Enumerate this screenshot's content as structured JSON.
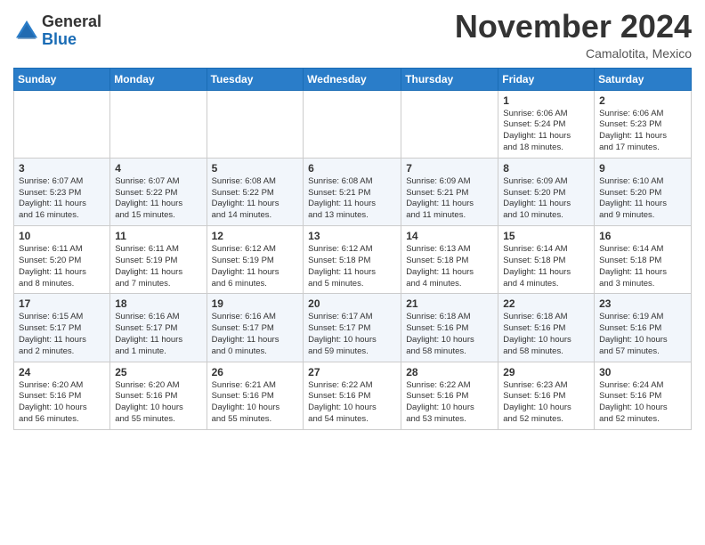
{
  "header": {
    "logo_line1": "General",
    "logo_line2": "Blue",
    "month": "November 2024",
    "location": "Camalotita, Mexico"
  },
  "weekdays": [
    "Sunday",
    "Monday",
    "Tuesday",
    "Wednesday",
    "Thursday",
    "Friday",
    "Saturday"
  ],
  "weeks": [
    [
      {
        "day": "",
        "info": ""
      },
      {
        "day": "",
        "info": ""
      },
      {
        "day": "",
        "info": ""
      },
      {
        "day": "",
        "info": ""
      },
      {
        "day": "",
        "info": ""
      },
      {
        "day": "1",
        "info": "Sunrise: 6:06 AM\nSunset: 5:24 PM\nDaylight: 11 hours\nand 18 minutes."
      },
      {
        "day": "2",
        "info": "Sunrise: 6:06 AM\nSunset: 5:23 PM\nDaylight: 11 hours\nand 17 minutes."
      }
    ],
    [
      {
        "day": "3",
        "info": "Sunrise: 6:07 AM\nSunset: 5:23 PM\nDaylight: 11 hours\nand 16 minutes."
      },
      {
        "day": "4",
        "info": "Sunrise: 6:07 AM\nSunset: 5:22 PM\nDaylight: 11 hours\nand 15 minutes."
      },
      {
        "day": "5",
        "info": "Sunrise: 6:08 AM\nSunset: 5:22 PM\nDaylight: 11 hours\nand 14 minutes."
      },
      {
        "day": "6",
        "info": "Sunrise: 6:08 AM\nSunset: 5:21 PM\nDaylight: 11 hours\nand 13 minutes."
      },
      {
        "day": "7",
        "info": "Sunrise: 6:09 AM\nSunset: 5:21 PM\nDaylight: 11 hours\nand 11 minutes."
      },
      {
        "day": "8",
        "info": "Sunrise: 6:09 AM\nSunset: 5:20 PM\nDaylight: 11 hours\nand 10 minutes."
      },
      {
        "day": "9",
        "info": "Sunrise: 6:10 AM\nSunset: 5:20 PM\nDaylight: 11 hours\nand 9 minutes."
      }
    ],
    [
      {
        "day": "10",
        "info": "Sunrise: 6:11 AM\nSunset: 5:20 PM\nDaylight: 11 hours\nand 8 minutes."
      },
      {
        "day": "11",
        "info": "Sunrise: 6:11 AM\nSunset: 5:19 PM\nDaylight: 11 hours\nand 7 minutes."
      },
      {
        "day": "12",
        "info": "Sunrise: 6:12 AM\nSunset: 5:19 PM\nDaylight: 11 hours\nand 6 minutes."
      },
      {
        "day": "13",
        "info": "Sunrise: 6:12 AM\nSunset: 5:18 PM\nDaylight: 11 hours\nand 5 minutes."
      },
      {
        "day": "14",
        "info": "Sunrise: 6:13 AM\nSunset: 5:18 PM\nDaylight: 11 hours\nand 4 minutes."
      },
      {
        "day": "15",
        "info": "Sunrise: 6:14 AM\nSunset: 5:18 PM\nDaylight: 11 hours\nand 4 minutes."
      },
      {
        "day": "16",
        "info": "Sunrise: 6:14 AM\nSunset: 5:18 PM\nDaylight: 11 hours\nand 3 minutes."
      }
    ],
    [
      {
        "day": "17",
        "info": "Sunrise: 6:15 AM\nSunset: 5:17 PM\nDaylight: 11 hours\nand 2 minutes."
      },
      {
        "day": "18",
        "info": "Sunrise: 6:16 AM\nSunset: 5:17 PM\nDaylight: 11 hours\nand 1 minute."
      },
      {
        "day": "19",
        "info": "Sunrise: 6:16 AM\nSunset: 5:17 PM\nDaylight: 11 hours\nand 0 minutes."
      },
      {
        "day": "20",
        "info": "Sunrise: 6:17 AM\nSunset: 5:17 PM\nDaylight: 10 hours\nand 59 minutes."
      },
      {
        "day": "21",
        "info": "Sunrise: 6:18 AM\nSunset: 5:16 PM\nDaylight: 10 hours\nand 58 minutes."
      },
      {
        "day": "22",
        "info": "Sunrise: 6:18 AM\nSunset: 5:16 PM\nDaylight: 10 hours\nand 58 minutes."
      },
      {
        "day": "23",
        "info": "Sunrise: 6:19 AM\nSunset: 5:16 PM\nDaylight: 10 hours\nand 57 minutes."
      }
    ],
    [
      {
        "day": "24",
        "info": "Sunrise: 6:20 AM\nSunset: 5:16 PM\nDaylight: 10 hours\nand 56 minutes."
      },
      {
        "day": "25",
        "info": "Sunrise: 6:20 AM\nSunset: 5:16 PM\nDaylight: 10 hours\nand 55 minutes."
      },
      {
        "day": "26",
        "info": "Sunrise: 6:21 AM\nSunset: 5:16 PM\nDaylight: 10 hours\nand 55 minutes."
      },
      {
        "day": "27",
        "info": "Sunrise: 6:22 AM\nSunset: 5:16 PM\nDaylight: 10 hours\nand 54 minutes."
      },
      {
        "day": "28",
        "info": "Sunrise: 6:22 AM\nSunset: 5:16 PM\nDaylight: 10 hours\nand 53 minutes."
      },
      {
        "day": "29",
        "info": "Sunrise: 6:23 AM\nSunset: 5:16 PM\nDaylight: 10 hours\nand 52 minutes."
      },
      {
        "day": "30",
        "info": "Sunrise: 6:24 AM\nSunset: 5:16 PM\nDaylight: 10 hours\nand 52 minutes."
      }
    ]
  ]
}
